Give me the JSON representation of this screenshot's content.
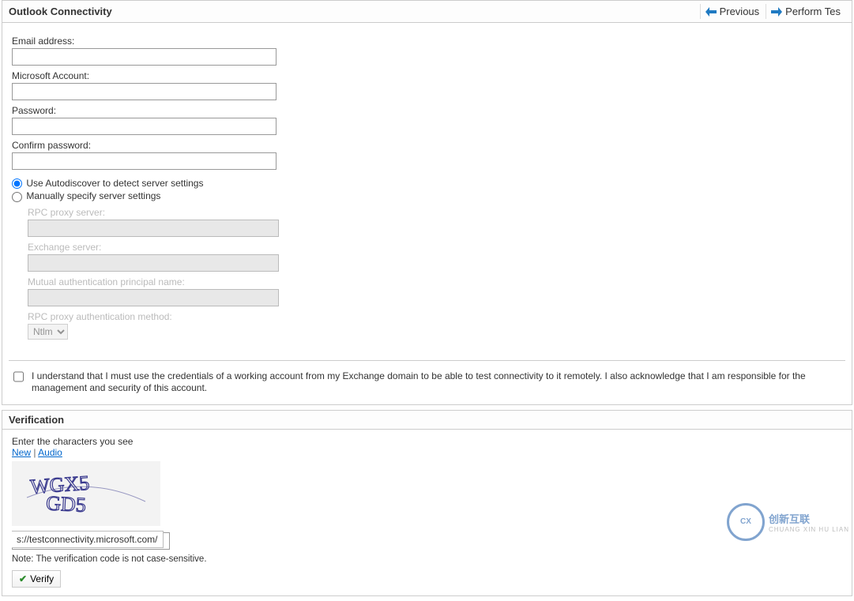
{
  "header": {
    "title": "Outlook Connectivity",
    "previous_label": "Previous",
    "perform_label": "Perform Tes"
  },
  "form": {
    "email_label": "Email address:",
    "email_value": "",
    "msaccount_label": "Microsoft Account:",
    "msaccount_value": "",
    "password_label": "Password:",
    "password_value": "",
    "confirm_label": "Confirm password:",
    "confirm_value": "",
    "radio_autodiscover": "Use Autodiscover to detect server settings",
    "radio_manual": "Manually specify server settings",
    "rpc_proxy_label": "RPC proxy server:",
    "rpc_proxy_value": "",
    "exchange_label": "Exchange server:",
    "exchange_value": "",
    "mutual_auth_label": "Mutual authentication principal name:",
    "mutual_auth_value": "",
    "rpc_auth_method_label": "RPC proxy authentication method:",
    "rpc_auth_method_value": "Ntlm",
    "consent_text": "I understand that I must use the credentials of a working account from my Exchange domain to be able to test connectivity to it remotely. I also acknowledge that I am responsible for the management and security of this account."
  },
  "verification": {
    "title": "Verification",
    "prompt": "Enter the characters you see",
    "link_new": "New",
    "link_audio": "Audio",
    "captcha_text": "WGX5 GD5",
    "url_overlay": "s://testconnectivity.microsoft.com/",
    "note": "Note: The verification code is not case-sensitive.",
    "verify_label": "Verify"
  },
  "watermark": {
    "text": "创新互联"
  }
}
